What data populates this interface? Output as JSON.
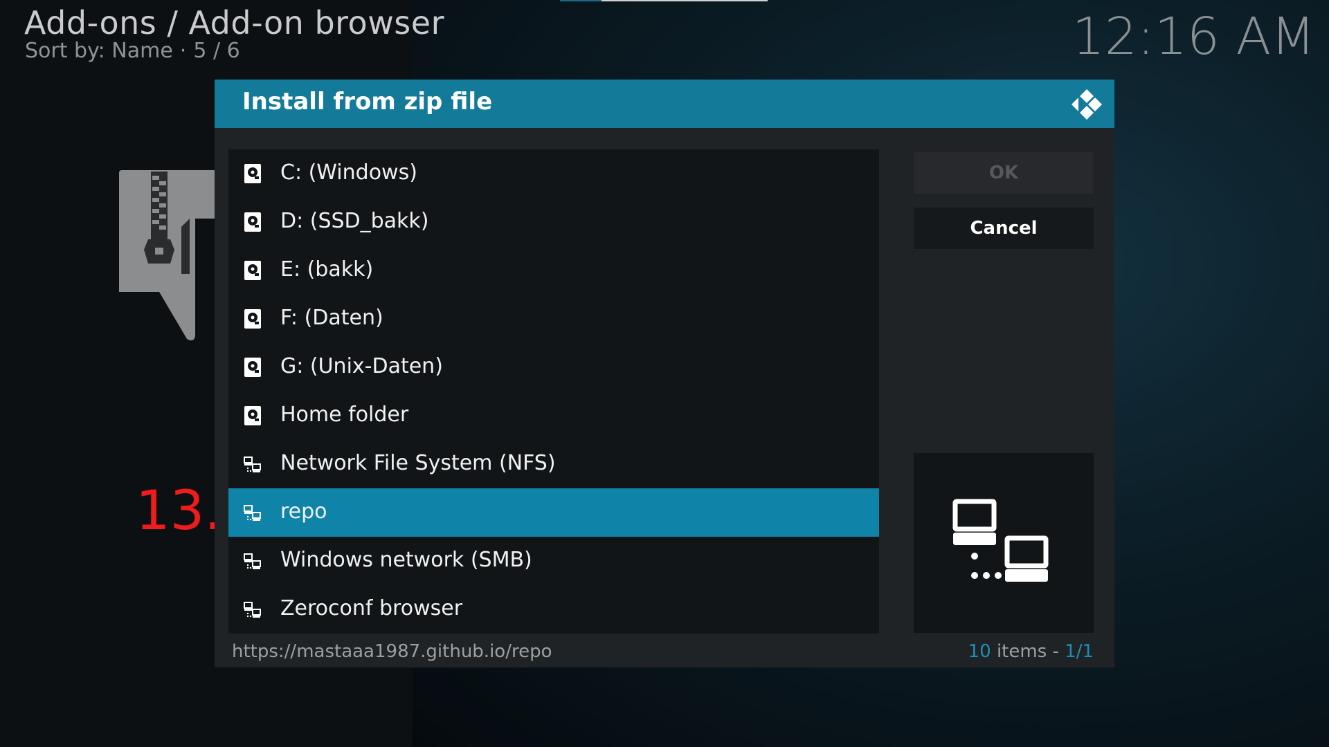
{
  "header": {
    "title": "Add-ons / Add-on browser",
    "sort_label": "Sort by: Name",
    "separator": "·",
    "position": "5 / 6",
    "clock": "12:16 AM"
  },
  "annotation": {
    "step": "13."
  },
  "dialog": {
    "title": "Install from zip file",
    "items": [
      {
        "label": "C: (Windows)",
        "icon": "hard-drive-icon"
      },
      {
        "label": "D: (SSD_bakk)",
        "icon": "hard-drive-icon"
      },
      {
        "label": "E: (bakk)",
        "icon": "hard-drive-icon"
      },
      {
        "label": "F: (Daten)",
        "icon": "hard-drive-icon"
      },
      {
        "label": "G: (Unix-Daten)",
        "icon": "hard-drive-icon"
      },
      {
        "label": "Home folder",
        "icon": "hard-drive-icon"
      },
      {
        "label": "Network File System (NFS)",
        "icon": "network-icon"
      },
      {
        "label": "repo",
        "icon": "network-icon",
        "selected": true
      },
      {
        "label": "Windows network (SMB)",
        "icon": "network-icon"
      },
      {
        "label": "Zeroconf browser",
        "icon": "network-icon"
      }
    ],
    "ok_label": "OK",
    "cancel_label": "Cancel",
    "footer_path": "https://mastaaa1987.github.io/repo",
    "item_count": "10",
    "items_word": "items -",
    "page": "1/1"
  },
  "colors": {
    "header_bar": "#147a9a",
    "selected_row": "#0f84a8",
    "accent_text": "#1c8fb6",
    "annotation": "#ee1c1c"
  }
}
